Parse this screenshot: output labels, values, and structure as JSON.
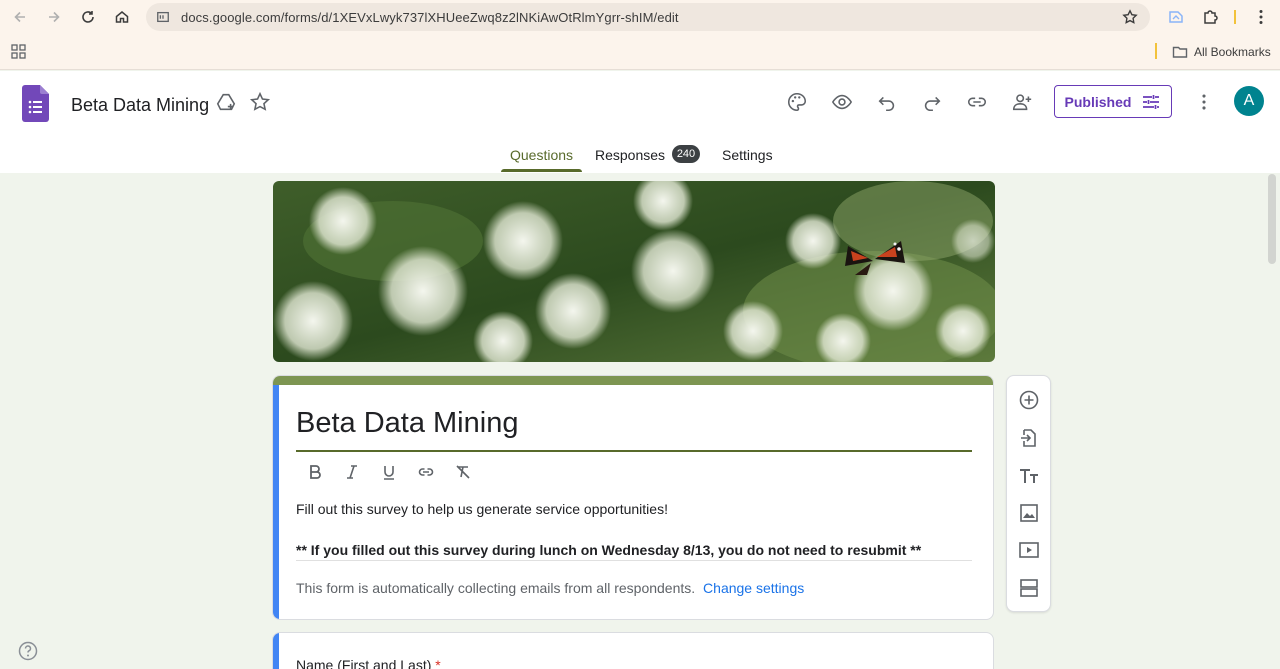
{
  "browser": {
    "url": "docs.google.com/forms/d/1XEVxLwyk737lXHUeeZwq8z2lNKiAwOtRlmYgrr-shIM/edit",
    "bookmarks_label": "All Bookmarks"
  },
  "header": {
    "doc_title": "Beta Data Mining",
    "published_label": "Published",
    "avatar_letter": "A",
    "accent_color": "#673ab7"
  },
  "tabs": {
    "questions": "Questions",
    "responses": "Responses",
    "responses_count": "240",
    "settings": "Settings"
  },
  "form": {
    "title": "Beta Data Mining",
    "description": "Fill out this survey to help us generate service opportunities!",
    "description_bold": "** If you filled out this survey during lunch on Wednesday 8/13, you do not need to resubmit **",
    "email_note": "This form is automatically collecting emails from all respondents.",
    "email_link": "Change settings",
    "theme_color": "#7d9552"
  },
  "question": {
    "title": "Name (First and Last)",
    "required_mark": "*"
  },
  "format_toolbar": [
    "bold-icon",
    "italic-icon",
    "underline-icon",
    "link-icon",
    "clear-format-icon"
  ],
  "side_toolbar": [
    "add-question-icon",
    "import-questions-icon",
    "add-title-icon",
    "add-image-icon",
    "add-video-icon",
    "add-section-icon"
  ]
}
